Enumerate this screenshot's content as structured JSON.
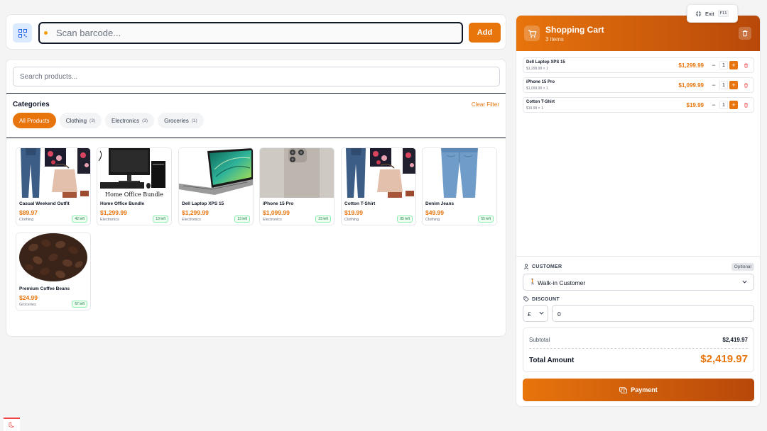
{
  "scan": {
    "placeholder": "Scan barcode...",
    "add_label": "Add"
  },
  "search": {
    "placeholder": "Search products..."
  },
  "categories": {
    "title": "Categories",
    "clear_label": "Clear Filter",
    "chips": [
      {
        "label": "All Products",
        "count": ""
      },
      {
        "label": "Clothing",
        "count": "(3)"
      },
      {
        "label": "Electronics",
        "count": "(3)"
      },
      {
        "label": "Groceries",
        "count": "(1)"
      }
    ]
  },
  "products": [
    {
      "name": "Casual Weekend Outfit",
      "price": "$89.97",
      "category": "Clothing",
      "stock": "42 left",
      "image": "outfit"
    },
    {
      "name": "Home Office Bundle",
      "price": "$1,299.99",
      "category": "Electronics",
      "stock": "13 left",
      "image": "office",
      "image_text": "Home Office Bundle"
    },
    {
      "name": "Dell Laptop XPS 15",
      "price": "$1,299.99",
      "category": "Electronics",
      "stock": "13 left",
      "image": "laptop"
    },
    {
      "name": "iPhone 15 Pro",
      "price": "$1,099.99",
      "category": "Electronics",
      "stock": "23 left",
      "image": "phone"
    },
    {
      "name": "Cotton T-Shirt",
      "price": "$19.99",
      "category": "Clothing",
      "stock": "85 left",
      "image": "outfit"
    },
    {
      "name": "Denim Jeans",
      "price": "$49.99",
      "category": "Clothing",
      "stock": "55 left",
      "image": "jeans"
    },
    {
      "name": "Premium Coffee Beans",
      "price": "$24.99",
      "category": "Groceries",
      "stock": "67 left",
      "image": "coffee"
    }
  ],
  "cart": {
    "title": "Shopping Cart",
    "count": "3 items",
    "items": [
      {
        "name": "Dell Laptop XPS 15",
        "sub": "$1,299.99 × 1",
        "total": "$1,299.99",
        "qty": "1"
      },
      {
        "name": "iPhone 15 Pro",
        "sub": "$1,099.99 × 1",
        "total": "$1,099.99",
        "qty": "1"
      },
      {
        "name": "Cotton T-Shirt",
        "sub": "$19.99 × 1",
        "total": "$19.99",
        "qty": "1"
      }
    ],
    "customer_label": "CUSTOMER",
    "optional_label": "Optional",
    "customer_value": "Walk-in Customer",
    "discount_label": "DISCOUNT",
    "discount_currency": "£",
    "discount_value": "0",
    "subtotal_label": "Subtotal",
    "subtotal_value": "$2,419.97",
    "total_label": "Total Amount",
    "total_value": "$2,419.97",
    "payment_label": "Payment"
  },
  "exit": {
    "label": "Exit",
    "key": "F11"
  },
  "colors": {
    "accent": "#e8740c",
    "accent_dark": "#b7480a"
  }
}
